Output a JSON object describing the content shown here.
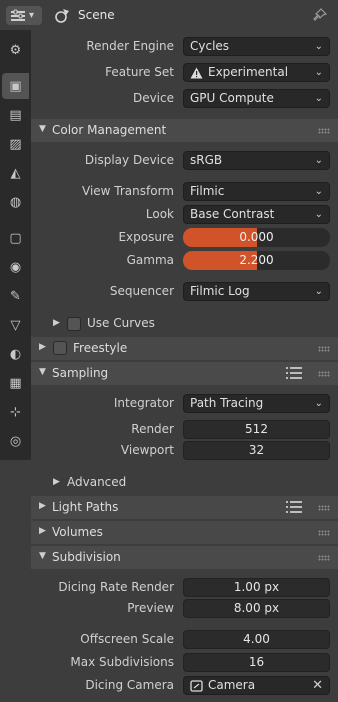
{
  "header": {
    "title": "Scene"
  },
  "tabs": [
    {
      "name": "tool-tab",
      "icon": "tool-icon",
      "glyph": "⚙",
      "active": false
    },
    {
      "name": "render-tab",
      "icon": "camera-back-icon",
      "glyph": "▣",
      "active": true
    },
    {
      "name": "output-tab",
      "icon": "printer-icon",
      "glyph": "▤",
      "active": false
    },
    {
      "name": "view-layer-tab",
      "icon": "image-layers-icon",
      "glyph": "▨",
      "active": false
    },
    {
      "name": "scene-tab",
      "icon": "scene-icon",
      "glyph": "◭",
      "active": false
    },
    {
      "name": "world-tab",
      "icon": "world-icon",
      "glyph": "◍",
      "active": false
    },
    {
      "name": "object-tab",
      "icon": "object-icon",
      "glyph": "▢",
      "active": false
    },
    {
      "name": "modifier-tab",
      "icon": "physics-icon",
      "glyph": "◉",
      "active": false
    },
    {
      "name": "wrench-tab",
      "icon": "wrench-icon",
      "glyph": "✎",
      "active": false
    },
    {
      "name": "data-tab",
      "icon": "mesh-data-icon",
      "glyph": "▽",
      "active": false
    },
    {
      "name": "material-tab",
      "icon": "material-icon",
      "glyph": "◐",
      "active": false
    },
    {
      "name": "texture-tab",
      "icon": "checker-icon",
      "glyph": "▦",
      "active": false
    },
    {
      "name": "constraint-tab",
      "icon": "constraint-icon",
      "glyph": "⊹",
      "active": false
    },
    {
      "name": "particles-tab",
      "icon": "particles-icon",
      "glyph": "◎",
      "active": false
    }
  ],
  "render": {
    "engine_label": "Render Engine",
    "engine_value": "Cycles",
    "feature_label": "Feature Set",
    "feature_value": "Experimental",
    "device_label": "Device",
    "device_value": "GPU Compute"
  },
  "color_management": {
    "title": "Color Management",
    "display_label": "Display Device",
    "display_value": "sRGB",
    "view_label": "View Transform",
    "view_value": "Filmic",
    "look_label": "Look",
    "look_value": "Base Contrast",
    "exposure_label": "Exposure",
    "exposure_value": "0.000",
    "exposure_fill": 0.5,
    "gamma_label": "Gamma",
    "gamma_value": "2.200",
    "gamma_fill": 0.5,
    "sequencer_label": "Sequencer",
    "sequencer_value": "Filmic Log",
    "curves_label": "Use Curves"
  },
  "freestyle": {
    "title": "Freestyle"
  },
  "sampling": {
    "title": "Sampling",
    "integrator_label": "Integrator",
    "integrator_value": "Path Tracing",
    "render_label": "Render",
    "render_value": "512",
    "viewport_label": "Viewport",
    "viewport_value": "32",
    "advanced_label": "Advanced"
  },
  "light_paths": {
    "title": "Light Paths"
  },
  "volumes": {
    "title": "Volumes"
  },
  "subdivision": {
    "title": "Subdivision",
    "dicing_render_label": "Dicing Rate Render",
    "dicing_render_value": "1.00 px",
    "preview_label": "Preview",
    "preview_value": "8.00 px",
    "offscreen_label": "Offscreen Scale",
    "offscreen_value": "4.00",
    "max_sub_label": "Max Subdivisions",
    "max_sub_value": "16",
    "camera_label": "Dicing Camera",
    "camera_value": "Camera"
  },
  "colors": {
    "accent": "#d0532a",
    "panel": "#4a4a4a",
    "field": "#282828"
  }
}
